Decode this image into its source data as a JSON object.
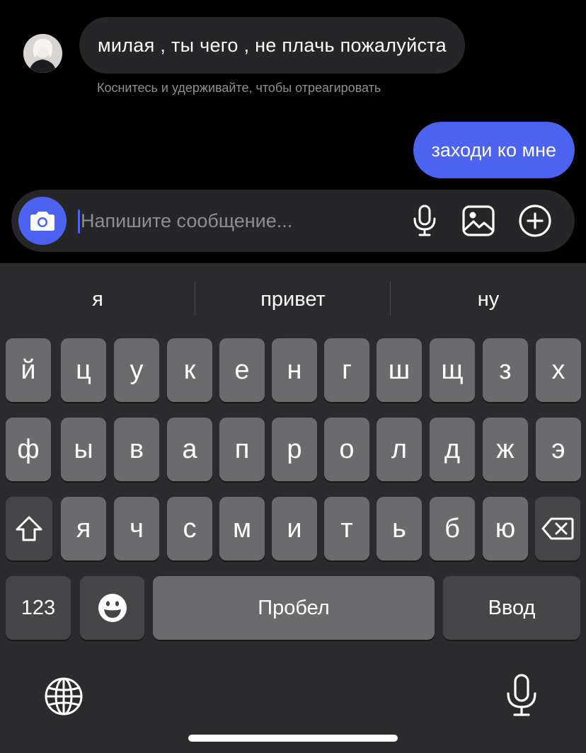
{
  "chat": {
    "incoming_message": "милая , ты чего , не плачь пожалуйста",
    "reaction_hint": "Коснитесь и удерживайте, чтобы отреагировать",
    "outgoing_message": "заходи ко мне"
  },
  "composer": {
    "placeholder": "Напишите сообщение...",
    "value": "",
    "icons": [
      "camera-icon",
      "microphone-icon",
      "image-icon",
      "plus-icon"
    ]
  },
  "keyboard": {
    "suggestions": [
      "я",
      "привет",
      "ну"
    ],
    "row1": [
      "й",
      "ц",
      "у",
      "к",
      "е",
      "н",
      "г",
      "ш",
      "щ",
      "з",
      "х"
    ],
    "row2": [
      "ф",
      "ы",
      "в",
      "а",
      "п",
      "р",
      "о",
      "л",
      "д",
      "ж",
      "э"
    ],
    "row3": [
      "я",
      "ч",
      "с",
      "м",
      "и",
      "т",
      "ь",
      "б",
      "ю"
    ],
    "numbers_key": "123",
    "space_key": "Пробел",
    "return_key": "Ввод",
    "icons": [
      "shift-icon",
      "backspace-icon",
      "emoji-icon",
      "globe-icon",
      "dictation-icon"
    ]
  },
  "colors": {
    "accent": "#4c63f2",
    "bubble_incoming": "#262628",
    "keyboard_bg": "#2b2b2d",
    "key_light": "#6b6b6e",
    "key_dark": "#464648"
  }
}
